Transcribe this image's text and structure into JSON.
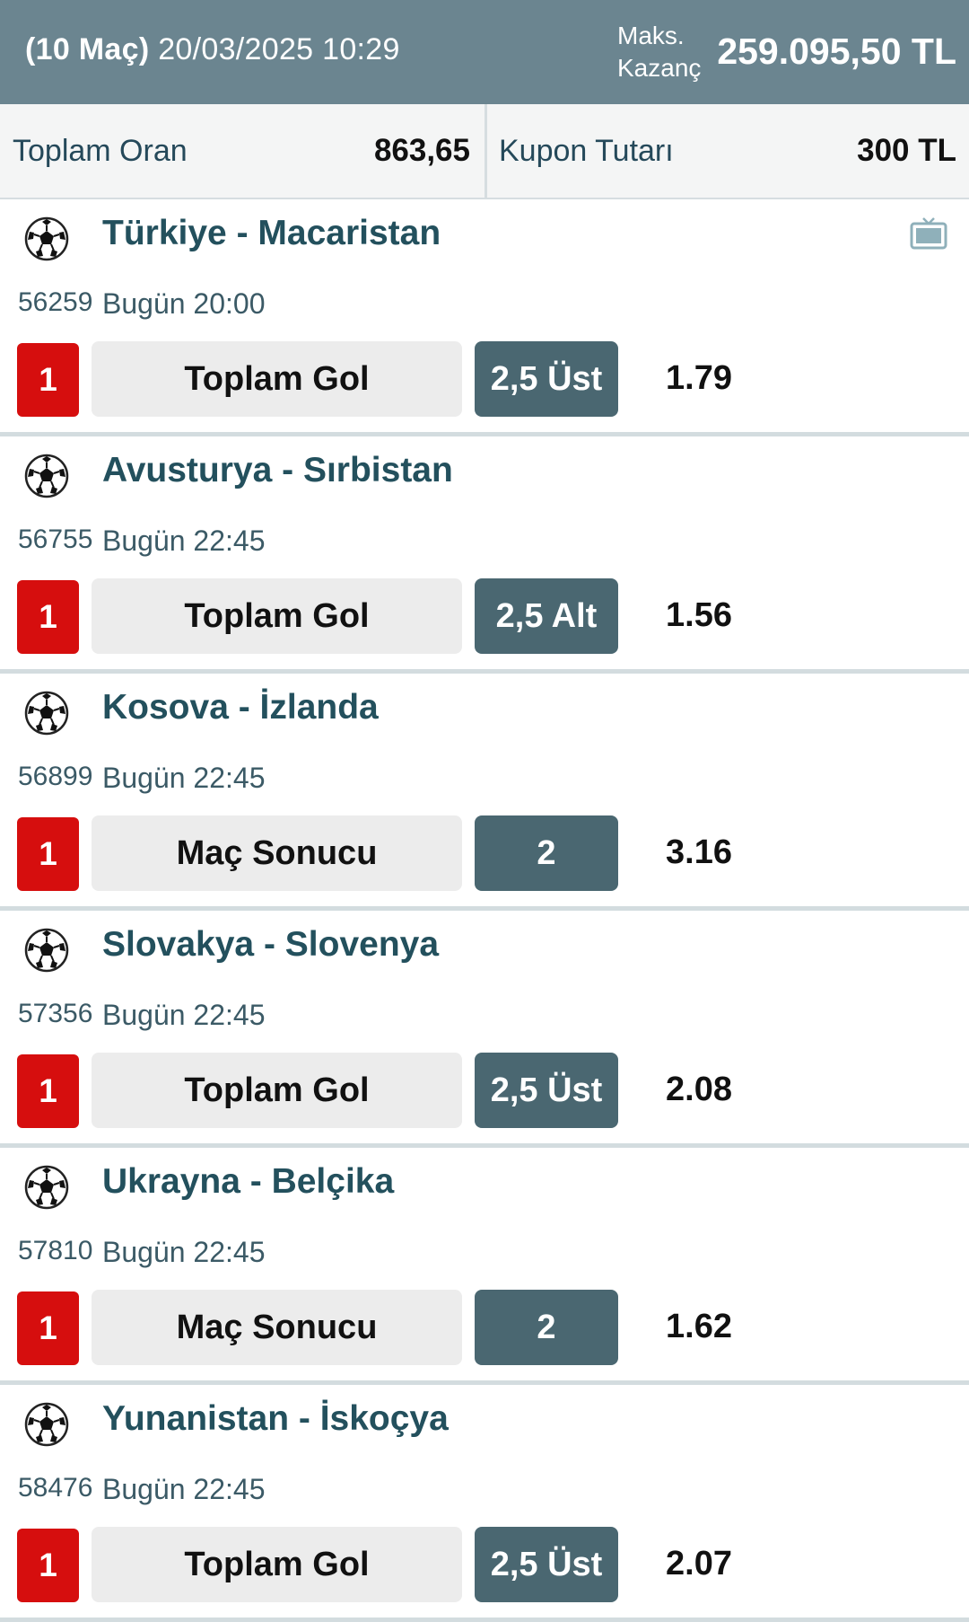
{
  "header": {
    "match_count": "(10 Maç)",
    "datetime": "20/03/2025 10:29",
    "max_win_line1": "Maks.",
    "max_win_line2": "Kazanç",
    "max_win_amount": "259.095,50 TL"
  },
  "summary": {
    "total_odds_label": "Toplam Oran",
    "total_odds_value": "863,65",
    "coupon_amount_label": "Kupon Tutarı",
    "coupon_amount_value": "300 TL"
  },
  "icons": {
    "sport": "soccer-ball-icon",
    "tv": "tv-icon"
  },
  "colors": {
    "header_bg": "#6b8590",
    "mbs_red": "#d60e0e",
    "pick_bg": "#4a6771",
    "team_text": "#23505d"
  },
  "matches": [
    {
      "teams": "Türkiye - Macaristan",
      "code": "56259",
      "time": "Bugün 20:00",
      "mbs": "1",
      "market": "Toplam Gol",
      "pick": "2,5 Üst",
      "odd": "1.79",
      "tv": true
    },
    {
      "teams": "Avusturya - Sırbistan",
      "code": "56755",
      "time": "Bugün 22:45",
      "mbs": "1",
      "market": "Toplam Gol",
      "pick": "2,5 Alt",
      "odd": "1.56"
    },
    {
      "teams": "Kosova - İzlanda",
      "code": "56899",
      "time": "Bugün 22:45",
      "mbs": "1",
      "market": "Maç Sonucu",
      "pick": "2",
      "odd": "3.16"
    },
    {
      "teams": "Slovakya - Slovenya",
      "code": "57356",
      "time": "Bugün 22:45",
      "mbs": "1",
      "market": "Toplam Gol",
      "pick": "2,5 Üst",
      "odd": "2.08"
    },
    {
      "teams": "Ukrayna - Belçika",
      "code": "57810",
      "time": "Bugün 22:45",
      "mbs": "1",
      "market": "Maç Sonucu",
      "pick": "2",
      "odd": "1.62"
    },
    {
      "teams": "Yunanistan - İskoçya",
      "code": "58476",
      "time": "Bugün 22:45",
      "mbs": "1",
      "market": "Toplam Gol",
      "pick": "2,5 Üst",
      "odd": "2.07"
    }
  ]
}
